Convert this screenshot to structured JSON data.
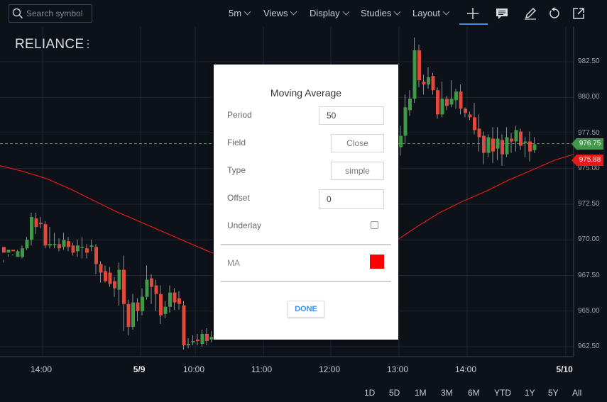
{
  "toolbar": {
    "search_placeholder": "Search symbol",
    "interval": "5m",
    "views": "Views",
    "display": "Display",
    "studies": "Studies",
    "layout": "Layout",
    "icons": [
      "search-icon",
      "crosshair-icon",
      "info-icon",
      "draw-icon",
      "undo-icon",
      "share-icon"
    ]
  },
  "chart": {
    "symbol": "RELIANCE",
    "current_price": "976.75",
    "ma_price": "975.88",
    "colors": {
      "up": "#3e9a46",
      "down": "#e0493c",
      "ma": "#e21a1a",
      "grid": "#1e2835",
      "background": "#0d1118"
    }
  },
  "chart_data": {
    "type": "candlestick",
    "title": "",
    "ylabel": "",
    "xlabel": "",
    "y_ticks": [
      "982.50",
      "980.00",
      "977.50",
      "975.00",
      "972.50",
      "970.00",
      "967.50",
      "965.00",
      "962.50"
    ],
    "x_ticks": [
      "14:00",
      "5/9",
      "10:00",
      "11:00",
      "12:00",
      "13:00",
      "14:00",
      "5/10"
    ],
    "x_ticks_bold": [
      false,
      true,
      false,
      false,
      false,
      false,
      false,
      true
    ],
    "ylim": [
      961.5,
      984.5
    ],
    "grid": true,
    "last_price": 976.75,
    "ma_value": 975.88,
    "moving_average": {
      "name": "MA",
      "period": 50,
      "points": [
        [
          0,
          975.2
        ],
        [
          5,
          974.8
        ],
        [
          10,
          974.3
        ],
        [
          15,
          973.6
        ],
        [
          20,
          972.8
        ],
        [
          25,
          972.0
        ],
        [
          30,
          971.3
        ],
        [
          35,
          970.6
        ],
        [
          40,
          969.9
        ],
        [
          45,
          969.2
        ],
        [
          50,
          968.6
        ],
        [
          55,
          968.0
        ],
        [
          60,
          967.6
        ],
        [
          70,
          967.4
        ],
        [
          75,
          967.8
        ],
        [
          80,
          968.7
        ],
        [
          85,
          969.8
        ],
        [
          90,
          970.9
        ],
        [
          95,
          971.9
        ],
        [
          100,
          972.7
        ],
        [
          105,
          973.4
        ],
        [
          110,
          974.2
        ],
        [
          115,
          974.9
        ],
        [
          120,
          975.6
        ],
        [
          124,
          976.0
        ]
      ]
    },
    "candles": [
      [
        969.5,
        969.1,
        968.4,
        968.6
      ],
      [
        969.1,
        969.3,
        969.0,
        968.8
      ],
      [
        969.3,
        969.2,
        968.9,
        969.0
      ],
      [
        968.8,
        969.2,
        969.3,
        968.9
      ],
      [
        968.8,
        969.4,
        969.6,
        968.7
      ],
      [
        969.4,
        970.0,
        970.2,
        969.3
      ],
      [
        970.0,
        971.6,
        971.9,
        969.6
      ],
      [
        971.5,
        970.9,
        971.9,
        970.4
      ],
      [
        971.2,
        971.1,
        971.6,
        970.8
      ],
      [
        971.1,
        969.6,
        971.3,
        969.4
      ],
      [
        969.6,
        969.7,
        970.9,
        969.4
      ],
      [
        969.7,
        969.7,
        970.5,
        969.4
      ],
      [
        969.7,
        969.4,
        970.1,
        969.2
      ],
      [
        969.5,
        970.0,
        970.5,
        969.3
      ],
      [
        969.9,
        969.5,
        970.2,
        969.2
      ],
      [
        969.6,
        969.1,
        969.8,
        968.9
      ],
      [
        969.2,
        969.6,
        970.0,
        968.8
      ],
      [
        969.5,
        969.5,
        970.2,
        968.7
      ],
      [
        969.4,
        969.1,
        969.7,
        968.7
      ],
      [
        969.5,
        969.6,
        970.0,
        969.2
      ],
      [
        969.5,
        968.3,
        969.7,
        967.6
      ],
      [
        968.3,
        967.7,
        968.5,
        967.0
      ],
      [
        967.8,
        967.1,
        968.2,
        967.0
      ],
      [
        967.7,
        966.9,
        968.1,
        966.7
      ],
      [
        967.1,
        966.6,
        967.4,
        966.0
      ],
      [
        966.5,
        967.9,
        968.4,
        965.4
      ],
      [
        967.9,
        965.5,
        968.9,
        963.6
      ],
      [
        965.5,
        963.9,
        965.8,
        963.3
      ],
      [
        963.9,
        965.6,
        966.2,
        963.7
      ],
      [
        965.6,
        965.0,
        965.9,
        964.3
      ],
      [
        965.0,
        966.0,
        966.6,
        964.7
      ],
      [
        966.0,
        967.2,
        968.2,
        965.8
      ],
      [
        967.3,
        966.7,
        967.6,
        965.5
      ],
      [
        966.8,
        966.2,
        967.2,
        965.0
      ],
      [
        966.2,
        964.7,
        966.8,
        964.1
      ],
      [
        964.8,
        965.3,
        965.7,
        964.5
      ],
      [
        965.3,
        966.3,
        966.8,
        964.9
      ],
      [
        966.3,
        965.6,
        966.6,
        965.1
      ],
      [
        965.9,
        965.5,
        966.4,
        965.1
      ],
      [
        965.4,
        962.6,
        965.7,
        962.3
      ],
      [
        962.6,
        962.7,
        963.1,
        962.4
      ],
      [
        962.8,
        962.9,
        963.3,
        962.6
      ],
      [
        963.0,
        962.9,
        963.4,
        962.6
      ],
      [
        962.7,
        963.4,
        963.7,
        962.5
      ],
      [
        963.4,
        962.9,
        963.8,
        962.6
      ],
      [
        963.0,
        963.2,
        963.6,
        962.8
      ],
      [
        976.5,
        977.3,
        978.0,
        975.9
      ],
      [
        977.3,
        979.3,
        980.2,
        976.8
      ],
      [
        979.1,
        979.9,
        980.5,
        978.7
      ],
      [
        979.9,
        983.3,
        984.2,
        979.6
      ],
      [
        983.3,
        981.2,
        983.7,
        980.7
      ],
      [
        981.1,
        980.9,
        981.6,
        980.2
      ],
      [
        980.9,
        981.4,
        982.1,
        980.6
      ],
      [
        981.5,
        980.5,
        981.7,
        980.2
      ],
      [
        980.5,
        978.8,
        980.7,
        978.5
      ],
      [
        978.8,
        979.9,
        981.1,
        978.6
      ],
      [
        979.9,
        979.4,
        980.1,
        979.1
      ],
      [
        979.5,
        979.9,
        981.2,
        979.3
      ],
      [
        979.8,
        980.4,
        980.6,
        979.2
      ],
      [
        980.4,
        979.2,
        980.9,
        978.8
      ],
      [
        979.2,
        978.9,
        979.3,
        978.6
      ],
      [
        978.8,
        978.6,
        979.0,
        978.4
      ],
      [
        978.6,
        977.7,
        979.6,
        977.4
      ],
      [
        977.8,
        977.2,
        978.8,
        976.2
      ],
      [
        977.3,
        976.1,
        977.6,
        975.3
      ],
      [
        976.1,
        977.2,
        977.4,
        975.8
      ],
      [
        977.1,
        976.2,
        977.9,
        975.4
      ],
      [
        976.4,
        977.1,
        977.9,
        975.6
      ],
      [
        977.0,
        976.0,
        977.4,
        975.2
      ],
      [
        976.0,
        977.2,
        977.9,
        975.8
      ],
      [
        977.1,
        976.9,
        977.5,
        976.1
      ],
      [
        976.9,
        977.7,
        978.0,
        976.2
      ],
      [
        977.6,
        976.6,
        977.8,
        976.3
      ],
      [
        976.8,
        976.9,
        977.2,
        975.8
      ],
      [
        976.9,
        976.2,
        977.6,
        975.5
      ],
      [
        976.3,
        976.7,
        977.2,
        976.1
      ]
    ],
    "candle_format": "open,close,high,low (visible candles only; dialog hides the middle span)",
    "ranges": [
      "1D",
      "5D",
      "1M",
      "3M",
      "6M",
      "YTD",
      "1Y",
      "5Y",
      "All"
    ]
  },
  "dialog": {
    "title": "Moving Average",
    "period_label": "Period",
    "period_value": "50",
    "field_label": "Field",
    "field_value": "Close",
    "type_label": "Type",
    "type_value": "simple",
    "offset_label": "Offset",
    "offset_value": "0",
    "underlay_label": "Underlay",
    "underlay_checked": false,
    "ma_label": "MA",
    "ma_color": "#ff0000",
    "done_label": "DONE"
  }
}
